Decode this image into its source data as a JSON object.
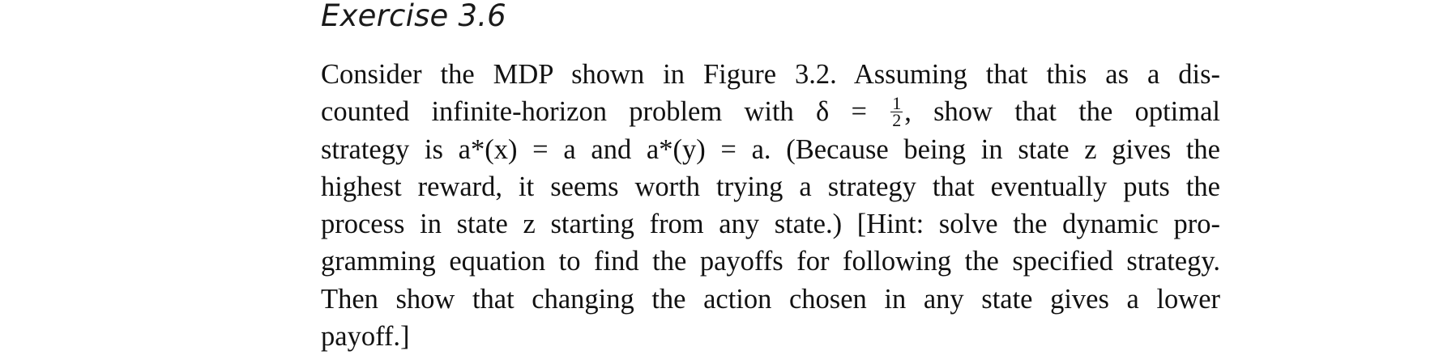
{
  "exercise": {
    "title": "Exercise 3.6",
    "lines": [
      "Consider the MDP shown in Figure 3.2. Assuming that this as a dis-",
      "counted infinite-horizon problem with δ",
      "=",
      "1",
      "2",
      ", show that the optimal",
      "strategy is a*(x) = a and a*(y) = a. (Because being in state z gives the",
      "highest reward, it seems worth trying a strategy that eventually puts the",
      "process in state z starting from any state.) [Hint: solve the dynamic pro-",
      "gramming equation to find the payoffs for following the specified strategy.",
      "Then show that changing the action chosen in any state gives a lower",
      "payoff.]"
    ]
  }
}
